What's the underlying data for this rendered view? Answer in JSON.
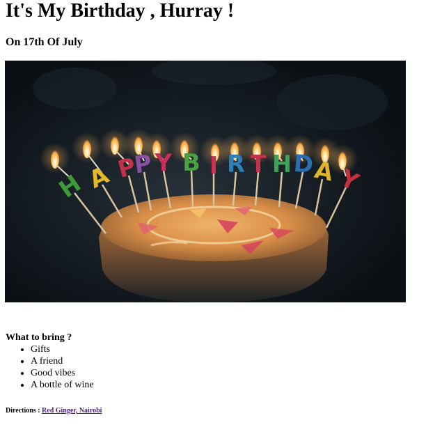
{
  "heading": "It's My Birthday , Hurray !",
  "subheading": "On 17th Of July",
  "hero_image": {
    "alt": "Birthday cake with Happy Birthday candles",
    "candle_letters": [
      "H",
      "A",
      "P",
      "P",
      "Y",
      "B",
      "I",
      "R",
      "T",
      "H",
      "D",
      "A",
      "Y"
    ],
    "candle_colors": [
      "#3f9b3a",
      "#e3b92a",
      "#c4324a",
      "#8a4fa3",
      "#c8305a",
      "#49a142",
      "#c93255",
      "#2d7fb8",
      "#c4324a",
      "#3fa05a",
      "#2b6fb2",
      "#e0b52c",
      "#c5323f"
    ]
  },
  "bring": {
    "title": "What to bring ?",
    "items": [
      "Gifts",
      "A friend",
      "Good vibes",
      "A bottle of wine"
    ]
  },
  "directions": {
    "label": "Directions :",
    "link_text": "Red Ginger, Nairobi"
  },
  "colors": {
    "link": "#551a8b",
    "image_bg": "#0f151b"
  }
}
